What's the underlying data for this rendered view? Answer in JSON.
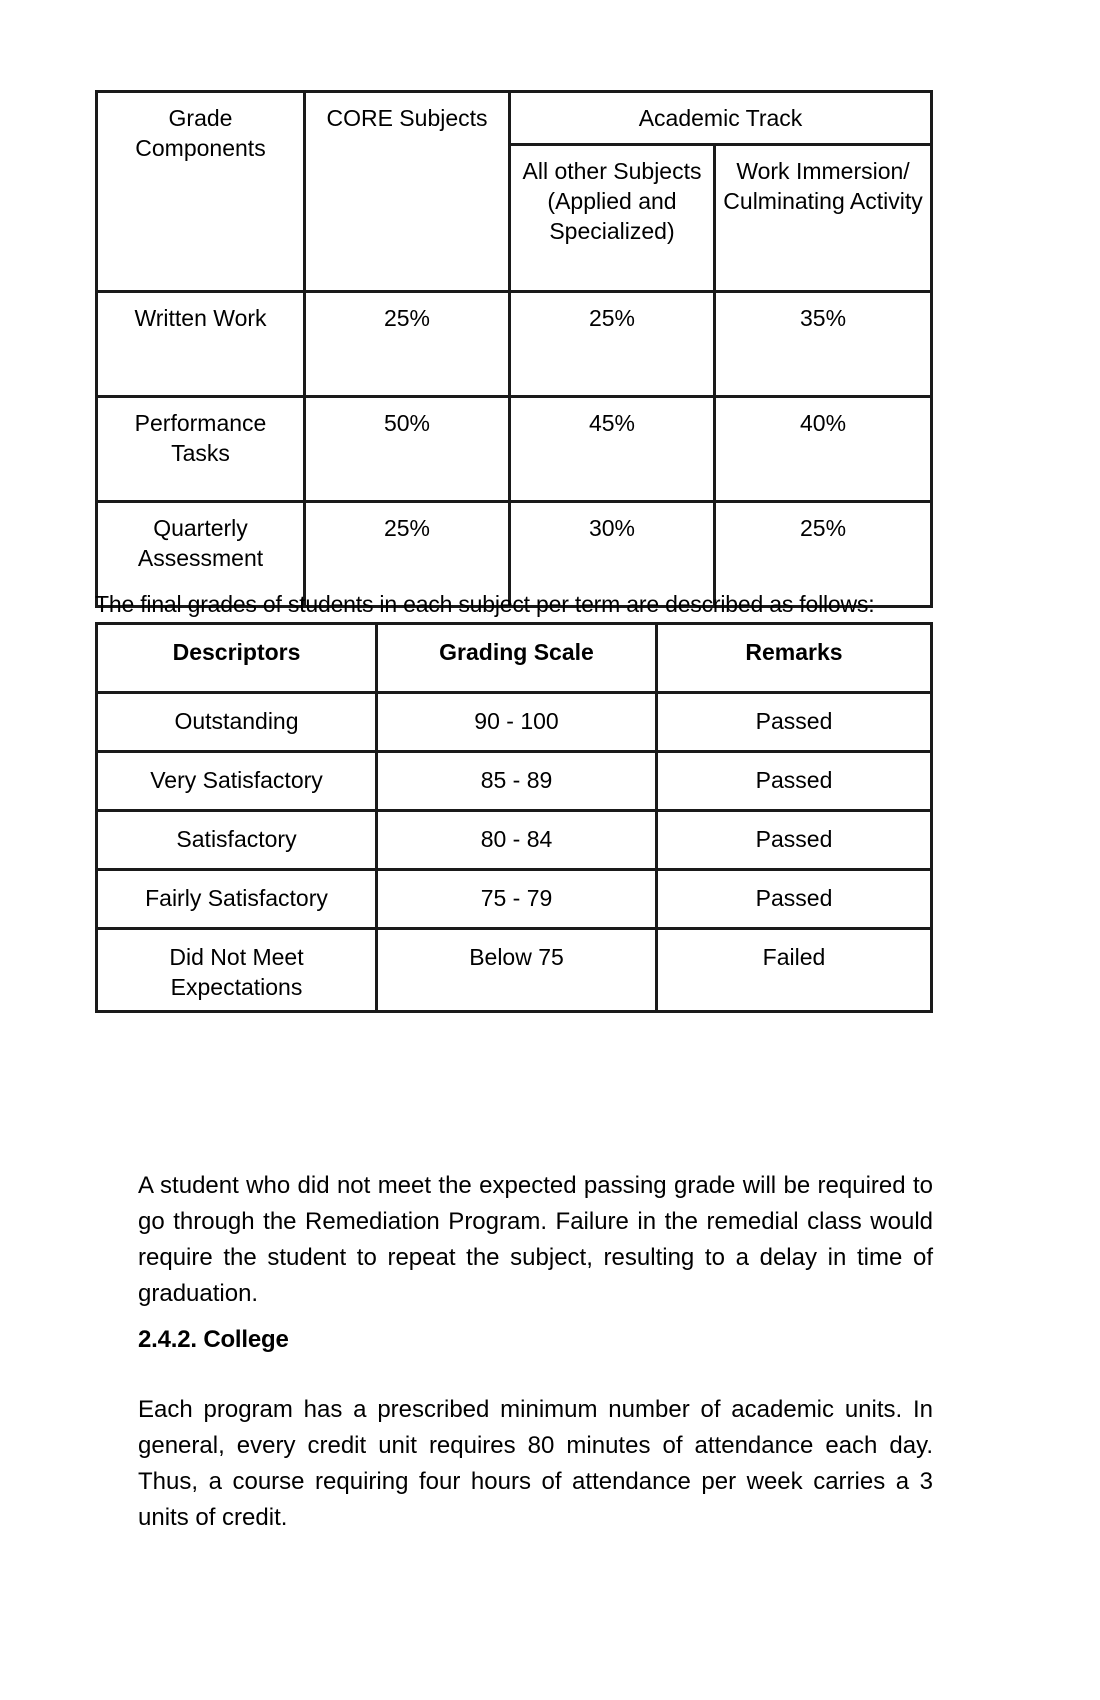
{
  "document": {
    "grade_components_table": {
      "headers": {
        "col1": "Grade Components",
        "col2": "CORE Subjects",
        "group": "Academic Track",
        "sub1": "All other Subjects (Applied and Specialized)",
        "sub2": "Work Immersion/ Culminating Activity"
      },
      "rows": [
        {
          "component": "Written Work",
          "core": "25%",
          "all_other": "25%",
          "work_immersion": "35%"
        },
        {
          "component": "Performance Tasks",
          "core": "50%",
          "all_other": "45%",
          "work_immersion": "40%"
        },
        {
          "component": "Quarterly Assessment",
          "core": "25%",
          "all_other": "30%",
          "work_immersion": "25%"
        }
      ]
    },
    "intro_sentence": "The final grades of students in each subject per term are described as follows:",
    "grading_scale_table": {
      "headers": [
        "Descriptors",
        "Grading Scale",
        "Remarks"
      ],
      "rows": [
        {
          "descriptor": "Outstanding",
          "scale": "90 - 100",
          "remark": "Passed"
        },
        {
          "descriptor": "Very Satisfactory",
          "scale": "85 - 89",
          "remark": "Passed"
        },
        {
          "descriptor": "Satisfactory",
          "scale": "80 - 84",
          "remark": "Passed"
        },
        {
          "descriptor": "Fairly Satisfactory",
          "scale": "75 - 79",
          "remark": "Passed"
        },
        {
          "descriptor": "Did Not Meet Expectations",
          "scale": "Below 75",
          "remark": "Failed"
        }
      ]
    },
    "paragraph_remediation": "A student who did not meet the expected passing grade will be required to go through the Remediation Program. Failure in the remedial class would require the student to repeat the subject, resulting to a delay in time of graduation.",
    "section_heading": "2.4.2. College",
    "paragraph_college": "Each program has a prescribed minimum number of academic units. In general, every credit unit requires 80 minutes of attendance each day. Thus, a course requiring four hours of attendance per week carries a 3 units of credit."
  }
}
